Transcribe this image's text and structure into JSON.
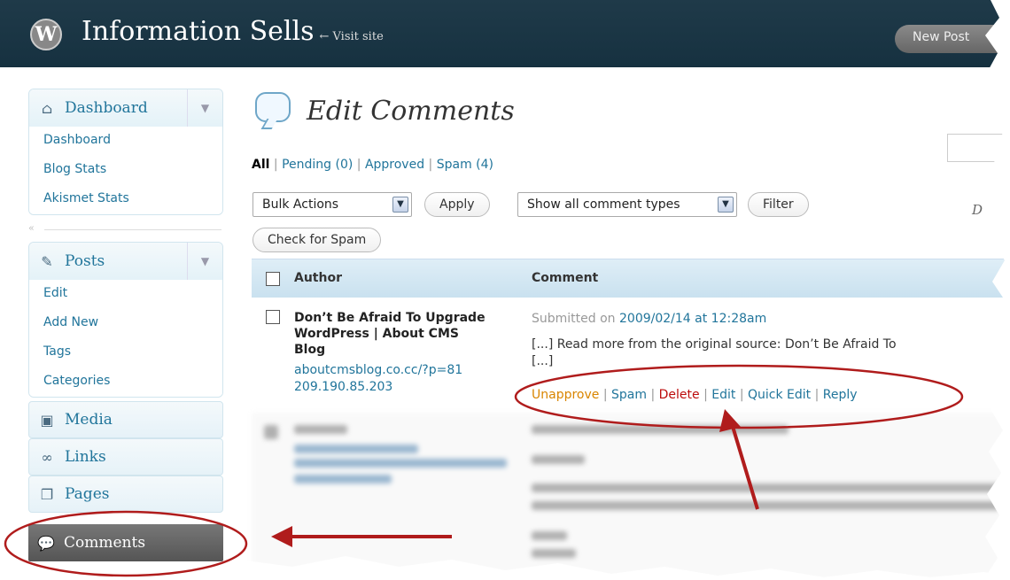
{
  "header": {
    "logo_glyph": "W",
    "site_title": "Information Sells",
    "visit_site": "← Visit site",
    "new_post": "New Post"
  },
  "sidebar": {
    "dashboard": {
      "label": "Dashboard",
      "icon": "house-icon",
      "items": [
        {
          "label": "Dashboard"
        },
        {
          "label": "Blog Stats"
        },
        {
          "label": "Akismet Stats"
        }
      ]
    },
    "collapse_glyph": "«",
    "posts": {
      "label": "Posts",
      "icon": "pushpin-icon",
      "items": [
        {
          "label": "Edit"
        },
        {
          "label": "Add New"
        },
        {
          "label": "Tags"
        },
        {
          "label": "Categories"
        }
      ]
    },
    "media": {
      "label": "Media",
      "icon": "media-icon"
    },
    "links": {
      "label": "Links",
      "icon": "link-icon"
    },
    "pages": {
      "label": "Pages",
      "icon": "pages-icon"
    },
    "comments": {
      "label": "Comments",
      "icon": "speech-bubble-icon"
    }
  },
  "main": {
    "title": "Edit Comments",
    "filters": {
      "all": "All",
      "pending": "Pending (0)",
      "approved": "Approved",
      "spam": "Spam (4)"
    },
    "bulk_actions": "Bulk Actions",
    "apply": "Apply",
    "comment_types": "Show all comment types",
    "filter": "Filter",
    "check_spam": "Check for Spam",
    "partial_right_text": "D",
    "table": {
      "col_author": "Author",
      "col_comment": "Comment",
      "row": {
        "author_name": "Don’t Be Afraid To Upgrade WordPress | About CMS Blog",
        "author_url": "aboutcmsblog.co.cc/?p=81",
        "author_ip": "209.190.85.203",
        "submitted_prefix": "Submitted on",
        "submitted_date": "2009/02/14 at 12:28am",
        "excerpt_line1": "[...] Read more from the original source: Don’t Be Afraid To",
        "excerpt_line2": "[...]",
        "actions": {
          "unapprove": "Unapprove",
          "spam": "Spam",
          "delete": "Delete",
          "edit": "Edit",
          "quick_edit": "Quick Edit",
          "reply": "Reply"
        }
      }
    }
  },
  "colors": {
    "header_bg": "#1f3a49",
    "link": "#21759b",
    "unapprove": "#d98500",
    "delete": "#bc0b0b",
    "annotation": "#b01c1c"
  }
}
